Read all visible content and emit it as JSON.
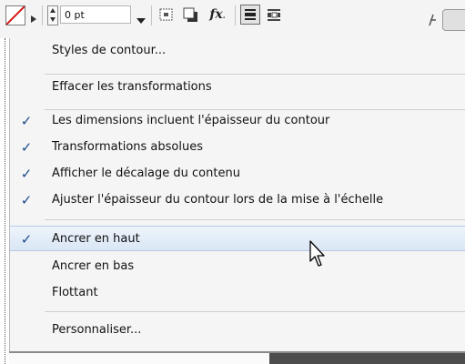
{
  "toolbar": {
    "stroke_weight": "0 pt",
    "fx_label": "fx",
    "fx_suffix": "."
  },
  "menu": {
    "items": [
      {
        "label": "Styles de contour...",
        "checked": false
      },
      {
        "label": "Effacer les transformations",
        "checked": false
      },
      {
        "label": "Les dimensions incluent l'épaisseur du contour",
        "checked": true
      },
      {
        "label": "Transformations absolues",
        "checked": true
      },
      {
        "label": "Afficher le décalage du contenu",
        "checked": true
      },
      {
        "label": "Ajuster l'épaisseur du contour lors de la mise à l'échelle",
        "checked": true
      },
      {
        "label": "Ancrer en haut",
        "checked": true,
        "highlighted": true
      },
      {
        "label": "Ancrer en bas",
        "checked": false
      },
      {
        "label": "Flottant",
        "checked": false
      },
      {
        "label": "Personnaliser...",
        "checked": false
      }
    ],
    "check_glyph": "✓"
  },
  "colors": {
    "check": "#1d4a8c",
    "highlight_top": "#eef4fb",
    "highlight_bottom": "#d9e6f5",
    "stroke_none_slash": "#d01818"
  },
  "icons": {
    "stroke_swatch": "stroke-none-swatch-icon",
    "arrow": "triangle-right-icon",
    "spinner": "up-down-spinner-icon",
    "dropdown": "dropdown-arrow-icon",
    "frame_fit": "frame-fitting-icon",
    "drop_shadow": "drop-shadow-icon",
    "effects": "fx-effects-icon",
    "text_wrap_bounding": "text-wrap-bounding-box-icon",
    "text_wrap_shape": "text-wrap-object-shape-icon",
    "pointer": "mouse-pointer-icon"
  }
}
